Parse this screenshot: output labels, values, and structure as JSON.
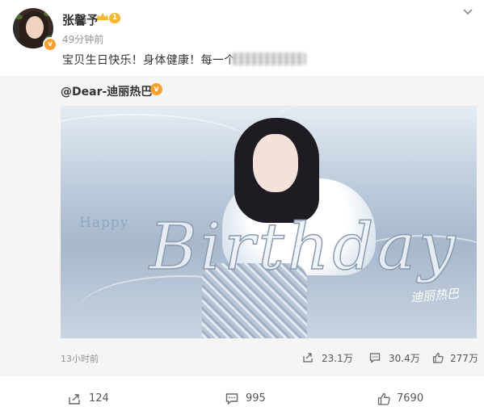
{
  "post": {
    "author_name": "张馨予",
    "level_badge": "1",
    "time": "49分钟前",
    "text": "宝贝生日快乐！身体健康！每一个"
  },
  "repost": {
    "author": "@Dear-迪丽热巴",
    "image": {
      "happy_text": "Happy",
      "birthday_text": "Birthday",
      "signature_text": "迪丽热巴"
    },
    "time": "13小时前",
    "shares": "23.1万",
    "comments": "30.4万",
    "likes": "277万"
  },
  "actions": {
    "shares": "124",
    "comments": "995",
    "likes": "7690"
  },
  "colors": {
    "verified_orange": "#f6a12b",
    "text_muted": "#939393",
    "repost_bg": "#f5f5f5"
  },
  "icons": [
    "chevron-down-icon",
    "verified-icon",
    "crown-icon",
    "share-icon",
    "comment-icon",
    "like-icon"
  ]
}
